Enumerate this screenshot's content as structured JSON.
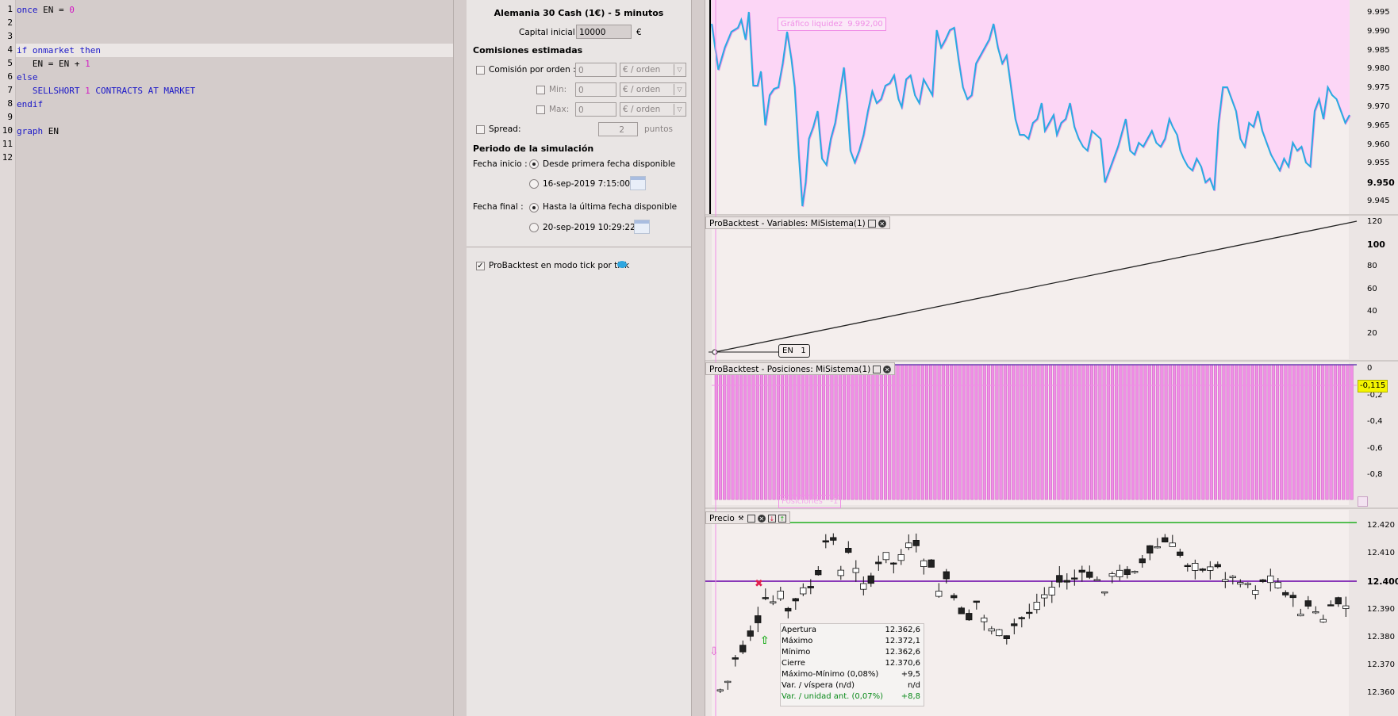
{
  "editor": {
    "line_numbers": [
      "1",
      "2",
      "3",
      "4",
      "5",
      "6",
      "7",
      "8",
      "9",
      "10",
      "11",
      "12"
    ],
    "lines": [
      [
        {
          "t": "once",
          "c": "kw"
        },
        {
          "t": " EN = ",
          "c": ""
        },
        {
          "t": "0",
          "c": "num"
        }
      ],
      [],
      [],
      [
        {
          "t": "if onmarket then",
          "c": "kw"
        }
      ],
      [
        {
          "t": "   EN = EN + ",
          "c": ""
        },
        {
          "t": "1",
          "c": "num"
        }
      ],
      [
        {
          "t": "else",
          "c": "kw"
        }
      ],
      [
        {
          "t": "   SELLSHORT ",
          "c": "kw"
        },
        {
          "t": "1",
          "c": "num"
        },
        {
          "t": " CONTRACTS AT MARKET",
          "c": "kw"
        }
      ],
      [
        {
          "t": "endif",
          "c": "kw"
        }
      ],
      [],
      [
        {
          "t": "graph",
          "c": "kw"
        },
        {
          "t": " EN",
          "c": ""
        }
      ],
      [],
      []
    ]
  },
  "settings": {
    "title": "Alemania 30 Cash (1€) - 5 minutos",
    "capital_label": "Capital inicial :",
    "capital_value": "10000",
    "capital_currency": "€",
    "commissions_title": "Comisiones estimadas",
    "commission_order_label": "Comisión por orden :",
    "commission_order_value": "0",
    "commission_order_unit": "€ / orden",
    "min_label": "Min:",
    "min_value": "0",
    "min_unit": "€ / orden",
    "max_label": "Max:",
    "max_value": "0",
    "max_unit": "€ / orden",
    "spread_label": "Spread:",
    "spread_value": "2",
    "spread_unit": "puntos",
    "period_title": "Periodo de la simulación",
    "start_label": "Fecha inicio :",
    "start_option1": "Desde primera fecha disponible",
    "start_option2": "16-sep-2019 7:15:00",
    "end_label": "Fecha final :",
    "end_option1": "Hasta la última fecha disponible",
    "end_option2": "20-sep-2019 10:29:22",
    "tick_mode_label": "ProBacktest en modo tick por tick"
  },
  "charts": {
    "equity_label": "Gráfico liquidez",
    "equity_value": "9.992,00",
    "equity_axis": [
      "9.995",
      "9.990",
      "9.985",
      "9.980",
      "9.975",
      "9.970",
      "9.965",
      "9.960",
      "9.955",
      "9.950",
      "9.945"
    ],
    "equity_axis_bold": "9.950",
    "variables_title": "ProBacktest - Variables: MiSistema(1)",
    "variables_axis": [
      "120",
      "100",
      "80",
      "60",
      "40",
      "20"
    ],
    "variables_axis_bold": "100",
    "en_label": "EN",
    "en_value": "1",
    "positions_title": "ProBacktest - Posiciones: MiSistema(1)",
    "positions_axis": [
      "0",
      "-0,2",
      "-0,4",
      "-0,6",
      "-0,8"
    ],
    "positions_current": "-0,115",
    "positions_label": "Posiciones",
    "positions_value": "-1",
    "price_title": "Precio",
    "price_axis": [
      "12.420",
      "12.410",
      "12.400",
      "12.390",
      "12.380",
      "12.370",
      "12.360"
    ],
    "price_axis_bold": "12.400"
  },
  "tooltip": {
    "rows": [
      {
        "k": "Apertura",
        "v": "12.362,6"
      },
      {
        "k": "Máximo",
        "v": "12.372,1"
      },
      {
        "k": "Mínimo",
        "v": "12.362,6"
      },
      {
        "k": "Cierre",
        "v": "12.370,6"
      },
      {
        "k": "Máximo-Mínimo (0,08%)",
        "v": "+9,5"
      },
      {
        "k": "Var. / víspera (n/d)",
        "v": "n/d"
      },
      {
        "k": "Var. / unidad ant. (0,07%)",
        "v": "+8,8",
        "green": true
      }
    ]
  },
  "colors": {
    "equity_fill": "#fcd6f6",
    "equity_line": "#29abe2",
    "equity_line2": "#f08ee6",
    "positions_fill": "#f08ee6",
    "price_line_green": "#1fae1f",
    "price_line_purple": "#7a1fb0"
  }
}
